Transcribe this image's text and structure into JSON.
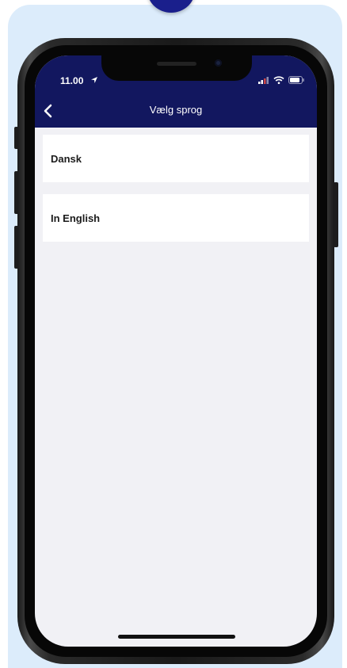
{
  "status_bar": {
    "time": "11.00"
  },
  "nav": {
    "title": "Vælg sprog",
    "back_icon": "chevron-left-icon"
  },
  "languages": [
    {
      "label": "Dansk"
    },
    {
      "label": "In English"
    }
  ],
  "colors": {
    "nav_background": "#12175f",
    "screen_background": "#f1f1f5",
    "page_background": "#dcecfb",
    "accent_circle": "#1a1f8c"
  }
}
